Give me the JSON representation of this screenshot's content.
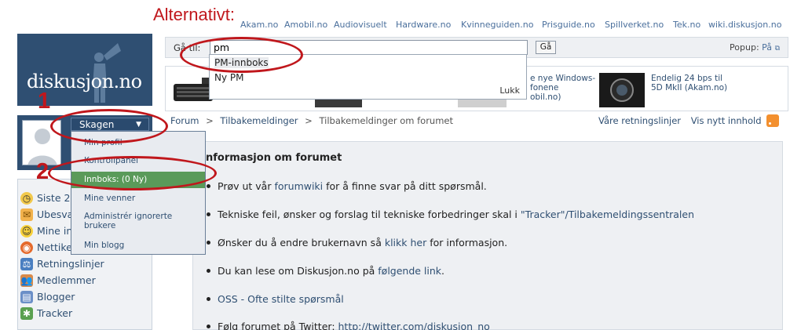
{
  "annotation": {
    "alternative_label": "Alternativt:",
    "marker_1": "1",
    "marker_2": "2"
  },
  "topnav": [
    "Akam.no",
    "Amobil.no",
    "Audiovisuelt",
    "Hardware.no",
    "Kvinneguiden.no",
    "Prisguide.no",
    "Spillverket.no",
    "Tek.no",
    "wiki.diskusjon.no"
  ],
  "logo": {
    "text": "diskusjon.no"
  },
  "user": {
    "name": "Skagen",
    "menu": [
      "Min profil",
      "Kontrollpanel",
      "Innboks: (0 Ny)",
      "Mine venner",
      "Administrér ignorerte brukere",
      "Min blogg"
    ]
  },
  "left_nav": [
    "Siste 2",
    "Ubesva",
    "Mine in",
    "Nettike",
    "Retningslinjer",
    "Medlemmer",
    "Blogger",
    "Tracker"
  ],
  "goto": {
    "label": "Gå til:",
    "value": "pm",
    "button": "Gå",
    "popup_label": "Popup:",
    "popup_value": "På",
    "suggestions": [
      "PM-innboks",
      "Ny PM"
    ],
    "close": "Lukk"
  },
  "news": [
    {
      "line1": "e nye Windows-",
      "line2": "fonene",
      "line3": "obil.no)"
    },
    {
      "line1": "Endelig 24 bps til",
      "line2": "5D MkII (Akam.no)"
    }
  ],
  "breadcrumb": [
    "Forum",
    "Tilbakemeldinger",
    "Tilbakemeldinger om forumet"
  ],
  "breadcrumb_sep": ">",
  "header_links": [
    "Våre retningslinjer",
    "Vis nytt innhold"
  ],
  "content": {
    "title": "nformasjon om forumet",
    "bullets": [
      {
        "before": "Prøv ut vår ",
        "link": "forumwiki",
        "after": " for å finne svar på ditt spørsmål."
      },
      {
        "before": "Tekniske feil, ønsker og forslag til tekniske forbedringer skal i ",
        "link": "\"Tracker\"/Tilbakemeldingssentralen",
        "after": ""
      },
      {
        "before": "Ønsker du å endre brukernavn så ",
        "link": "klikk her",
        "after": " for informasjon."
      },
      {
        "before": "Du kan lese om Diskusjon.no på ",
        "link": "følgende link",
        "after": "."
      },
      {
        "before": "",
        "link": "OSS - Ofte stilte spørsmål",
        "after": ""
      },
      {
        "before": "Følg forumet på Twitter: ",
        "link": "http://twitter.com/diskusjon_no",
        "after": ""
      }
    ]
  },
  "colors": {
    "annotation": "#c0171c",
    "brand": "#2f4f72",
    "link": "#2f4f72",
    "menu_highlight": "#5a9a5a"
  }
}
